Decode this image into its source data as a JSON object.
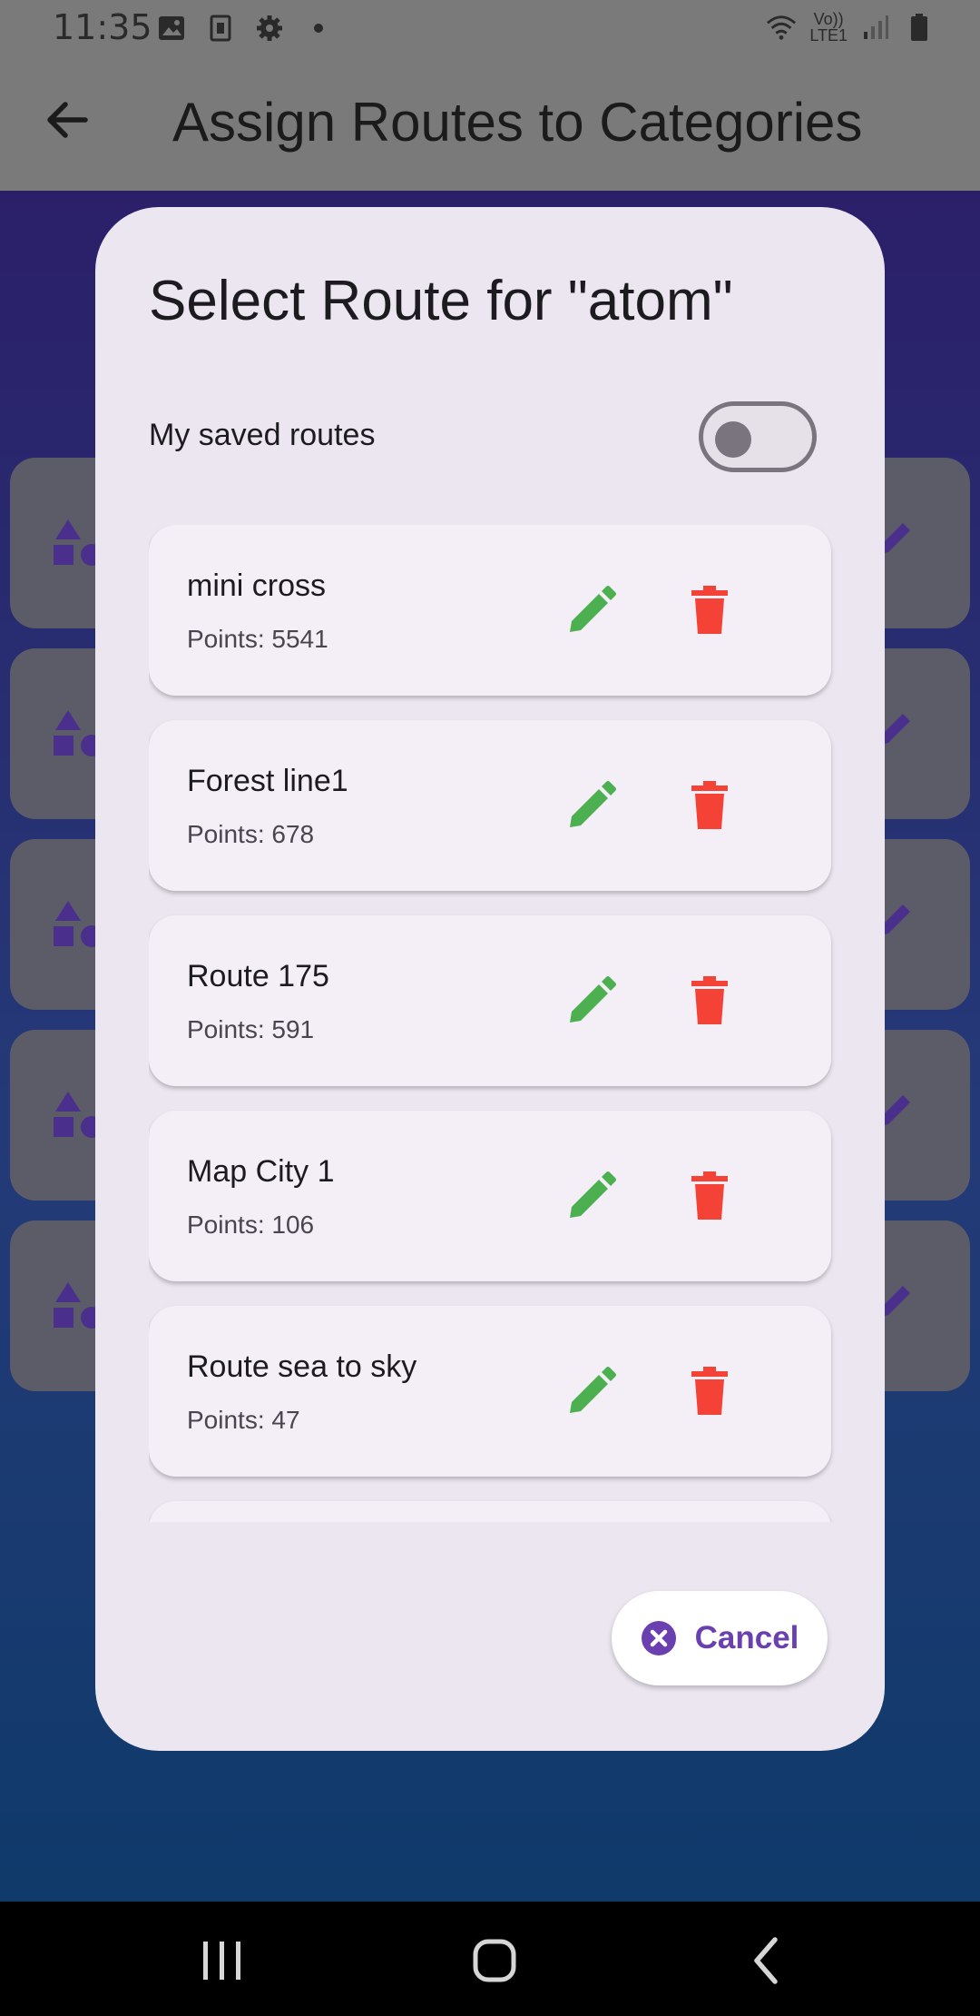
{
  "status_bar": {
    "time": "11:35",
    "network_label": "Vo))",
    "network_label_2": "LTE1",
    "icons": [
      "image-icon",
      "sim-icon",
      "gear-icon",
      "dot-icon",
      "wifi-icon",
      "signal-icon",
      "battery-icon"
    ]
  },
  "app_bar": {
    "title": "Assign Routes to Categories",
    "back_icon": "arrow-left-icon"
  },
  "dialog": {
    "title": "Select Route for \"atom\"",
    "toggle": {
      "label": "My saved routes",
      "on": false
    },
    "routes": [
      {
        "name": "mini cross",
        "points": "Points: 5541"
      },
      {
        "name": "Forest line1",
        "points": "Points: 678"
      },
      {
        "name": "Route 175",
        "points": "Points: 591"
      },
      {
        "name": "Map City 1",
        "points": "Points: 106"
      },
      {
        "name": "Route sea to sky",
        "points": "Points: 47"
      }
    ],
    "cancel_label": "Cancel"
  },
  "colors": {
    "edit": "#4caf50",
    "delete": "#f44336",
    "accent": "#6a3fb0"
  }
}
